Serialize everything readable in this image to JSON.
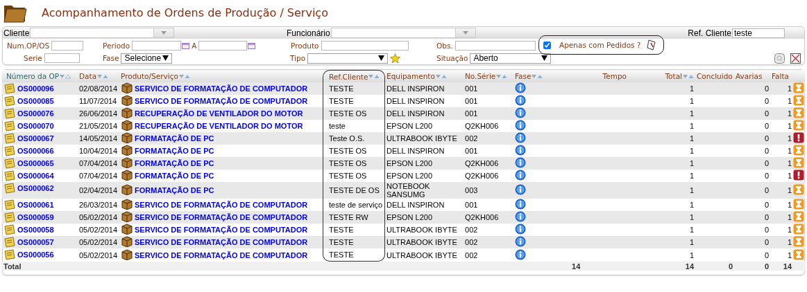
{
  "header": {
    "title": "Acompanhamento de Ordens de Produção / Serviço"
  },
  "filters": {
    "cliente": {
      "label": "Cliente",
      "kind": "combo"
    },
    "funcionario": {
      "label": "Funcionário",
      "kind": "combo"
    },
    "ref_cliente": {
      "label": "Ref. Cliente",
      "kind": "text",
      "value": "teste"
    },
    "num_op": {
      "label": "Num.OP/OS",
      "kind": "text"
    },
    "periodo_inicio": {
      "label": "Periodo",
      "kind": "date"
    },
    "periodo_fim": {
      "label": "A",
      "kind": "date"
    },
    "produto": {
      "label": "Produto",
      "kind": "text"
    },
    "obs": {
      "label": "Obs.",
      "kind": "text"
    },
    "apenas_pedidos": {
      "label": "Apenas com Pedidos ?",
      "checked": true
    },
    "serie": {
      "label": "Serie",
      "kind": "text"
    },
    "fase": {
      "label": "Fase",
      "kind": "select",
      "value": "Selecione"
    },
    "tipo": {
      "label": "Tipo",
      "kind": "select"
    },
    "situacao": {
      "label": "Situação",
      "kind": "select",
      "value": "Aberto"
    }
  },
  "table": {
    "columns": [
      {
        "label": "Número da OP",
        "sortable": true,
        "sorted": true,
        "highlighted": false
      },
      {
        "label": "Data",
        "sortable": true,
        "sorted": false,
        "highlighted": false
      },
      {
        "label": "Produto/Serviço",
        "sortable": true,
        "sorted": false,
        "highlighted": false
      },
      {
        "label": "Ref.Cliente",
        "sortable": true,
        "sorted": false,
        "highlighted": true
      },
      {
        "label": "Equipamento",
        "sortable": true,
        "sorted": false,
        "highlighted": false
      },
      {
        "label": "No.Série",
        "sortable": true,
        "sorted": false,
        "highlighted": false
      },
      {
        "label": "Fase",
        "sortable": true,
        "sorted": false,
        "highlighted": false
      },
      {
        "label": "Tempo",
        "sortable": false,
        "sorted": false,
        "highlighted": false
      },
      {
        "label": "Total",
        "sortable": true,
        "sorted": false,
        "highlighted": false
      },
      {
        "label": "Concluido",
        "sortable": false,
        "sorted": false,
        "highlighted": false
      },
      {
        "label": "Avarias",
        "sortable": false,
        "sorted": false,
        "highlighted": false
      },
      {
        "label": "Falta",
        "sortable": false,
        "sorted": false,
        "highlighted": false
      }
    ],
    "rows": [
      {
        "op": "OS000096",
        "data": "02/08/2014",
        "produto": "SERVICO DE FORMATAÇÃO DE COMPUTADOR",
        "ref_cliente": "TESTE",
        "equipamento": "DELL INSPIRON",
        "serie": "001",
        "total": "1",
        "avarias": "0",
        "falta": "1",
        "kind": "pending"
      },
      {
        "op": "OS000085",
        "data": "11/07/2014",
        "produto": "SERVICO DE FORMATAÇÃO DE COMPUTADOR",
        "ref_cliente": "TESTE",
        "equipamento": "DELL INSPIRON",
        "serie": "001",
        "total": "1",
        "avarias": "0",
        "falta": "1",
        "kind": "pending"
      },
      {
        "op": "OS000076",
        "data": "26/06/2014",
        "produto": "RECUPERAÇÃO DE VENTILADOR DO MOTOR",
        "ref_cliente": "TESTE OS",
        "equipamento": "DELL INSPIRON",
        "serie": "001",
        "total": "1",
        "avarias": "0",
        "falta": "1",
        "kind": "pending"
      },
      {
        "op": "OS000070",
        "data": "21/05/2014",
        "produto": "RECUPERAÇÃO DE VENTILADOR DO MOTOR",
        "ref_cliente": "teste",
        "equipamento": "EPSON L200",
        "serie": "Q2KH006",
        "total": "1",
        "avarias": "0",
        "falta": "1",
        "kind": "pending"
      },
      {
        "op": "OS000067",
        "data": "14/05/2014",
        "produto": "FORMATAÇÃO DE PC",
        "ref_cliente": "Teste O.S.",
        "equipamento": "ULTRABOOK IBYTE",
        "serie": "002",
        "total": "1",
        "avarias": "0",
        "falta": "1",
        "kind": "alert"
      },
      {
        "op": "OS000066",
        "data": "10/04/2014",
        "produto": "FORMATAÇÃO DE PC",
        "ref_cliente": "TESTE OS",
        "equipamento": "DELL INSPIRON",
        "serie": "001",
        "total": "1",
        "avarias": "0",
        "falta": "1",
        "kind": "pending"
      },
      {
        "op": "OS000065",
        "data": "07/04/2014",
        "produto": "FORMATAÇÃO DE PC",
        "ref_cliente": "TESTE OS",
        "equipamento": "EPSON L200",
        "serie": "Q2KH006",
        "total": "1",
        "avarias": "0",
        "falta": "1",
        "kind": "pending"
      },
      {
        "op": "OS000064",
        "data": "07/04/2014",
        "produto": "FORMATAÇÃO DE PC",
        "ref_cliente": "TESTE OS",
        "equipamento": "EPSON L200",
        "serie": "Q2KH006",
        "total": "1",
        "avarias": "0",
        "falta": "1",
        "kind": "alert"
      },
      {
        "op": "OS000062",
        "data": "02/04/2014",
        "produto": "FORMATAÇÃO DE PC",
        "ref_cliente": "TESTE DE OS",
        "equipamento": "NOTEBOOK SANSUMG",
        "serie": "003",
        "total": "1",
        "avarias": "0",
        "falta": "1",
        "kind": "pending"
      },
      {
        "op": "OS000061",
        "data": "26/03/2014",
        "produto": "SERVICO DE FORMATAÇÃO DE COMPUTADOR",
        "ref_cliente": "teste de serviço",
        "equipamento": "DELL INSPIRON",
        "serie": "001",
        "total": "1",
        "avarias": "0",
        "falta": "1",
        "kind": "pending"
      },
      {
        "op": "OS000059",
        "data": "05/02/2014",
        "produto": "SERVICO DE FORMATAÇÃO DE COMPUTADOR",
        "ref_cliente": "TESTE RW",
        "equipamento": "EPSON L200",
        "serie": "Q2KH006",
        "total": "1",
        "avarias": "0",
        "falta": "1",
        "kind": "pending"
      },
      {
        "op": "OS000058",
        "data": "05/02/2014",
        "produto": "SERVICO DE FORMATAÇÃO DE COMPUTADOR",
        "ref_cliente": "TESTE",
        "equipamento": "ULTRABOOK IBYTE",
        "serie": "002",
        "total": "1",
        "avarias": "0",
        "falta": "1",
        "kind": "pending"
      },
      {
        "op": "OS000057",
        "data": "05/02/2014",
        "produto": "SERVICO DE FORMATAÇÃO DE COMPUTADOR",
        "ref_cliente": "TESTE",
        "equipamento": "ULTRABOOK IBYTE",
        "serie": "002",
        "total": "1",
        "avarias": "0",
        "falta": "1",
        "kind": "pending"
      },
      {
        "op": "OS000056",
        "data": "05/02/2014",
        "produto": "SERVICO DE FORMATAÇÃO DE COMPUTADOR",
        "ref_cliente": "TESTE",
        "equipamento": "ULTRABOOK IBYTE",
        "serie": "002",
        "total": "1",
        "avarias": "0",
        "falta": "1",
        "kind": "pending"
      }
    ],
    "totals": {
      "label": "Total",
      "tempo": "14",
      "total": "14",
      "concluido": "0",
      "avarias": "0",
      "falta": "14"
    }
  }
}
